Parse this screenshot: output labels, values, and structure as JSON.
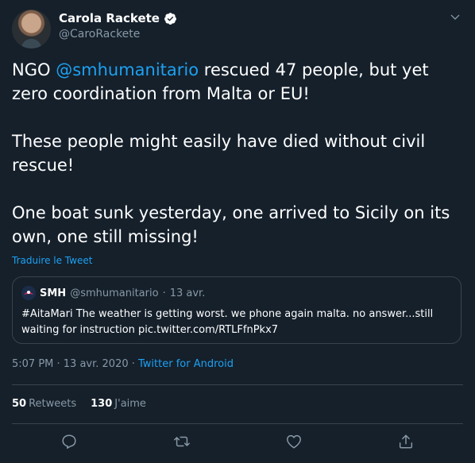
{
  "tweet": {
    "author": {
      "name": "Carola Rackete",
      "handle": "@CaroRackete",
      "verified": true
    },
    "text": {
      "p1_pre": "NGO ",
      "p1_mention": "@smhumanitario",
      "p1_post": " rescued 47 people, but yet zero coordination from Malta or EU!",
      "p2": "These people might easily have died without civil rescue!",
      "p3": "One boat sunk yesterday, one arrived to Sicily on its own, one still missing!"
    },
    "translate_label": "Traduire le Tweet",
    "quote": {
      "name": "SMH",
      "handle": "@smhumanitario",
      "separator": "·",
      "date": "13 avr.",
      "text": "#AitaMari The weather is getting worst. we phone again malta. no answer...still waiting for instruction pic.twitter.com/RTLFfnPkx7"
    },
    "time": "5:07 PM · 13 avr. 2020 · ",
    "source": "Twitter for Android",
    "stats": {
      "retweets_count": "50",
      "retweets_label": "Retweets",
      "likes_count": "130",
      "likes_label": "J'aime"
    }
  },
  "icons": {
    "verified": "verified-badge-icon",
    "more": "chevron-down-icon",
    "reply": "reply-icon",
    "retweet": "retweet-icon",
    "like": "heart-icon",
    "share": "share-icon"
  },
  "colors": {
    "background": "#15202b",
    "text": "#ffffff",
    "secondary_text": "#8899a6",
    "link": "#1da1f2",
    "border": "#38444d"
  }
}
